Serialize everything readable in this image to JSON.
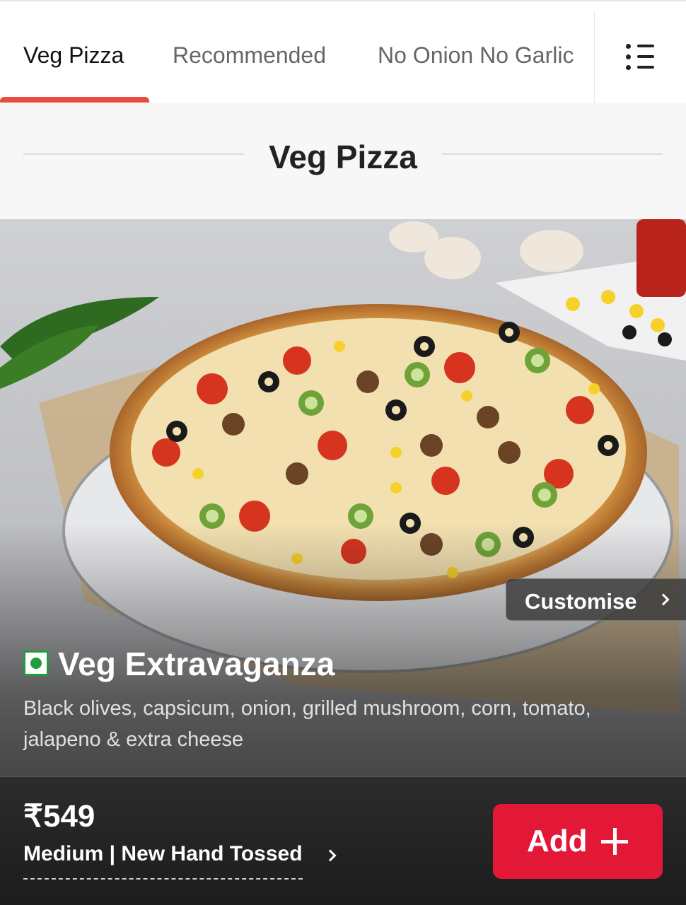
{
  "tabs": [
    {
      "label": "Veg Pizza",
      "active": true
    },
    {
      "label": "Recommended",
      "active": false
    },
    {
      "label": "No Onion No Garlic",
      "active": false
    }
  ],
  "menu": {
    "icon": "list-icon"
  },
  "section": {
    "title": "Veg Pizza"
  },
  "product": {
    "image_icon": "pizza-photo",
    "customise_label": "Customise",
    "veg_indicator_icon": "veg-mark-icon",
    "name": "Veg Extravaganza",
    "description": "Black olives, capsicum, onion, grilled mushroom, corn, tomato, jalapeno & extra cheese",
    "price": "₹549",
    "size_crust": "Medium | New Hand Tossed",
    "add_label": "Add"
  },
  "colors": {
    "accent": "#e31837",
    "tab_indicator": "#e74c3c",
    "veg_green": "#1f9d3a"
  }
}
